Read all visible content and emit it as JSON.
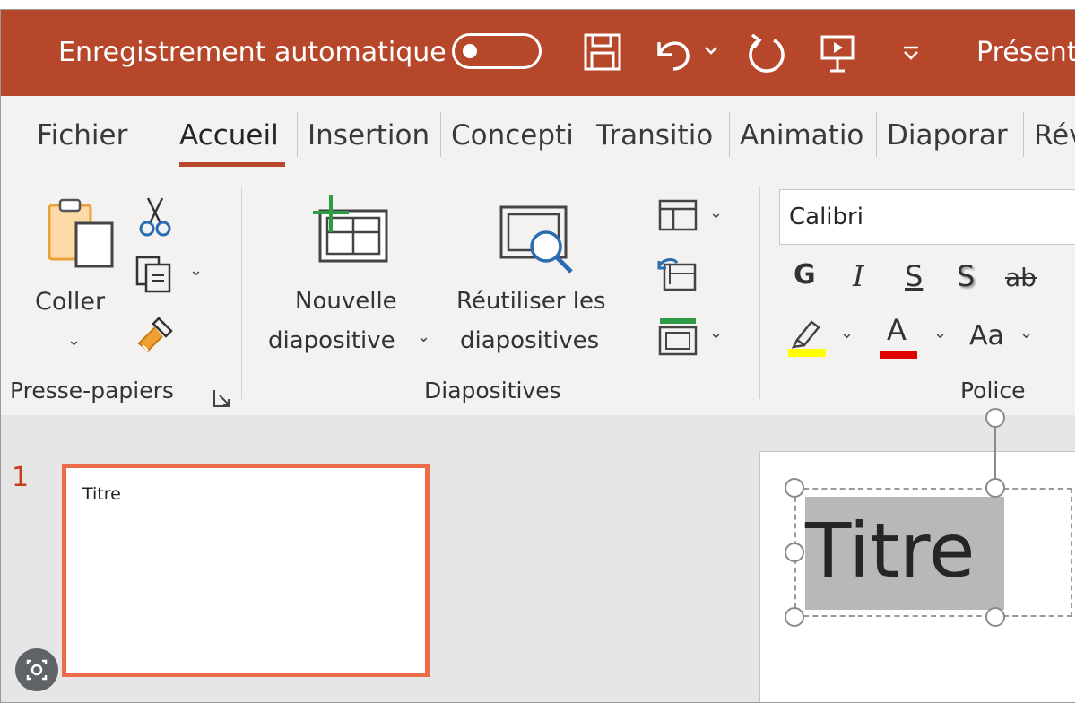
{
  "titlebar": {
    "autosave_label": "Enregistrement automatique",
    "autosave_state": "off",
    "doc_name": "Présent",
    "bg_color": "#b7472a",
    "icons": [
      "toggle-switch",
      "save-icon",
      "undo-icon",
      "redo-icon",
      "start-from-beginning-icon",
      "customize-toolbar-icon"
    ]
  },
  "tabs": {
    "items": [
      {
        "label": "Fichier"
      },
      {
        "label": "Accueil",
        "active": true
      },
      {
        "label": "Insertion"
      },
      {
        "label": "Concepti"
      },
      {
        "label": "Transitio"
      },
      {
        "label": "Animatio"
      },
      {
        "label": "Diaporar"
      },
      {
        "label": "Rév"
      }
    ]
  },
  "ribbon": {
    "clipboard": {
      "paste_label": "Coller",
      "group_label": "Presse-papiers",
      "icons": [
        "paste-icon",
        "cut-icon",
        "copy-icon",
        "format-painter-icon",
        "dialog-launcher-icon"
      ]
    },
    "slides": {
      "new_slide_line1": "Nouvelle",
      "new_slide_line2": "diapositive",
      "reuse_line1": "Réutiliser les",
      "reuse_line2": "diapositives",
      "group_label": "Diapositives",
      "icons": [
        "layout-icon",
        "reset-icon",
        "section-icon"
      ]
    },
    "font": {
      "font_name": "Calibri",
      "bold": "G",
      "italic": "I",
      "underline": "S",
      "shadow": "S",
      "strikethrough": "ab",
      "change_case": "Aa",
      "font_color_glyph": "A",
      "group_label": "Police",
      "highlight_color": "#ffff00",
      "font_color": "#e00000"
    }
  },
  "slide_panel": {
    "slides": [
      {
        "number": "1",
        "title": "Titre",
        "selected": true
      }
    ],
    "accent_color": "#ec6c4a"
  },
  "editor": {
    "title_text": "Titre",
    "title_selected": true
  }
}
